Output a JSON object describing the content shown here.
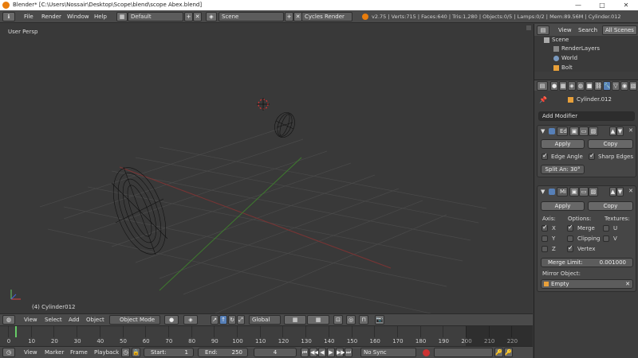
{
  "window": {
    "title": "Blender* [C:\\Users\\Nossair\\Desktop\\Scope\\blend\\scope Abex.blend]",
    "minimize": "—",
    "maximize": "□",
    "close": "✕"
  },
  "menu": {
    "items": [
      "File",
      "Render",
      "Window",
      "Help"
    ],
    "layout": "Default",
    "scene": "Scene",
    "engine": "Cycles Render",
    "stats": "v2.75 | Verts:715 | Faces:640 | Tris:1,280 | Objects:0/5 | Lamps:0/2 | Mem:89.56M | Cylinder.012"
  },
  "viewport": {
    "view_label": "User Persp",
    "object_label": "(4) Cylinder012"
  },
  "outliner": {
    "tabs": [
      "View",
      "Search",
      "All Scenes"
    ],
    "tree": [
      "Scene",
      "RenderLayers",
      "World",
      "Bolt"
    ]
  },
  "properties": {
    "object_name": "Cylinder.012",
    "add_modifier": "Add Modifier",
    "mod1": {
      "name": "Ed",
      "apply": "Apply",
      "copy": "Copy",
      "edge_angle": "Edge Angle",
      "sharp_edges": "Sharp Edges",
      "split_angle": "Split An: 30°"
    },
    "mod2": {
      "name": "Mi",
      "apply": "Apply",
      "copy": "Copy",
      "axis": "Axis:",
      "options": "Options:",
      "textures": "Textures:",
      "x": "X",
      "y": "Y",
      "z": "Z",
      "merge": "Merge",
      "clipping": "Clipping",
      "vertex": "Vertex",
      "u": "U",
      "v": "V",
      "merge_limit_label": "Merge Limit:",
      "merge_limit_value": "0.001000",
      "mirror_object": "Mirror Object:",
      "empty": "Empty"
    }
  },
  "header3d": {
    "view": "View",
    "select": "Select",
    "add": "Add",
    "object": "Object",
    "mode": "Object Mode",
    "orientation": "Global"
  },
  "timeline": {
    "ticks": [
      "0",
      "10",
      "20",
      "30",
      "40",
      "50",
      "60",
      "70",
      "80",
      "90",
      "100",
      "110",
      "120",
      "130",
      "140",
      "150",
      "160",
      "170",
      "180",
      "190",
      "200",
      "210",
      "220"
    ]
  },
  "timeline_header": {
    "view": "View",
    "marker": "Marker",
    "frame": "Frame",
    "playback": "Playback",
    "start": "Start:",
    "start_val": "1",
    "end": "End:",
    "end_val": "250",
    "current": "4",
    "sync": "No Sync"
  }
}
